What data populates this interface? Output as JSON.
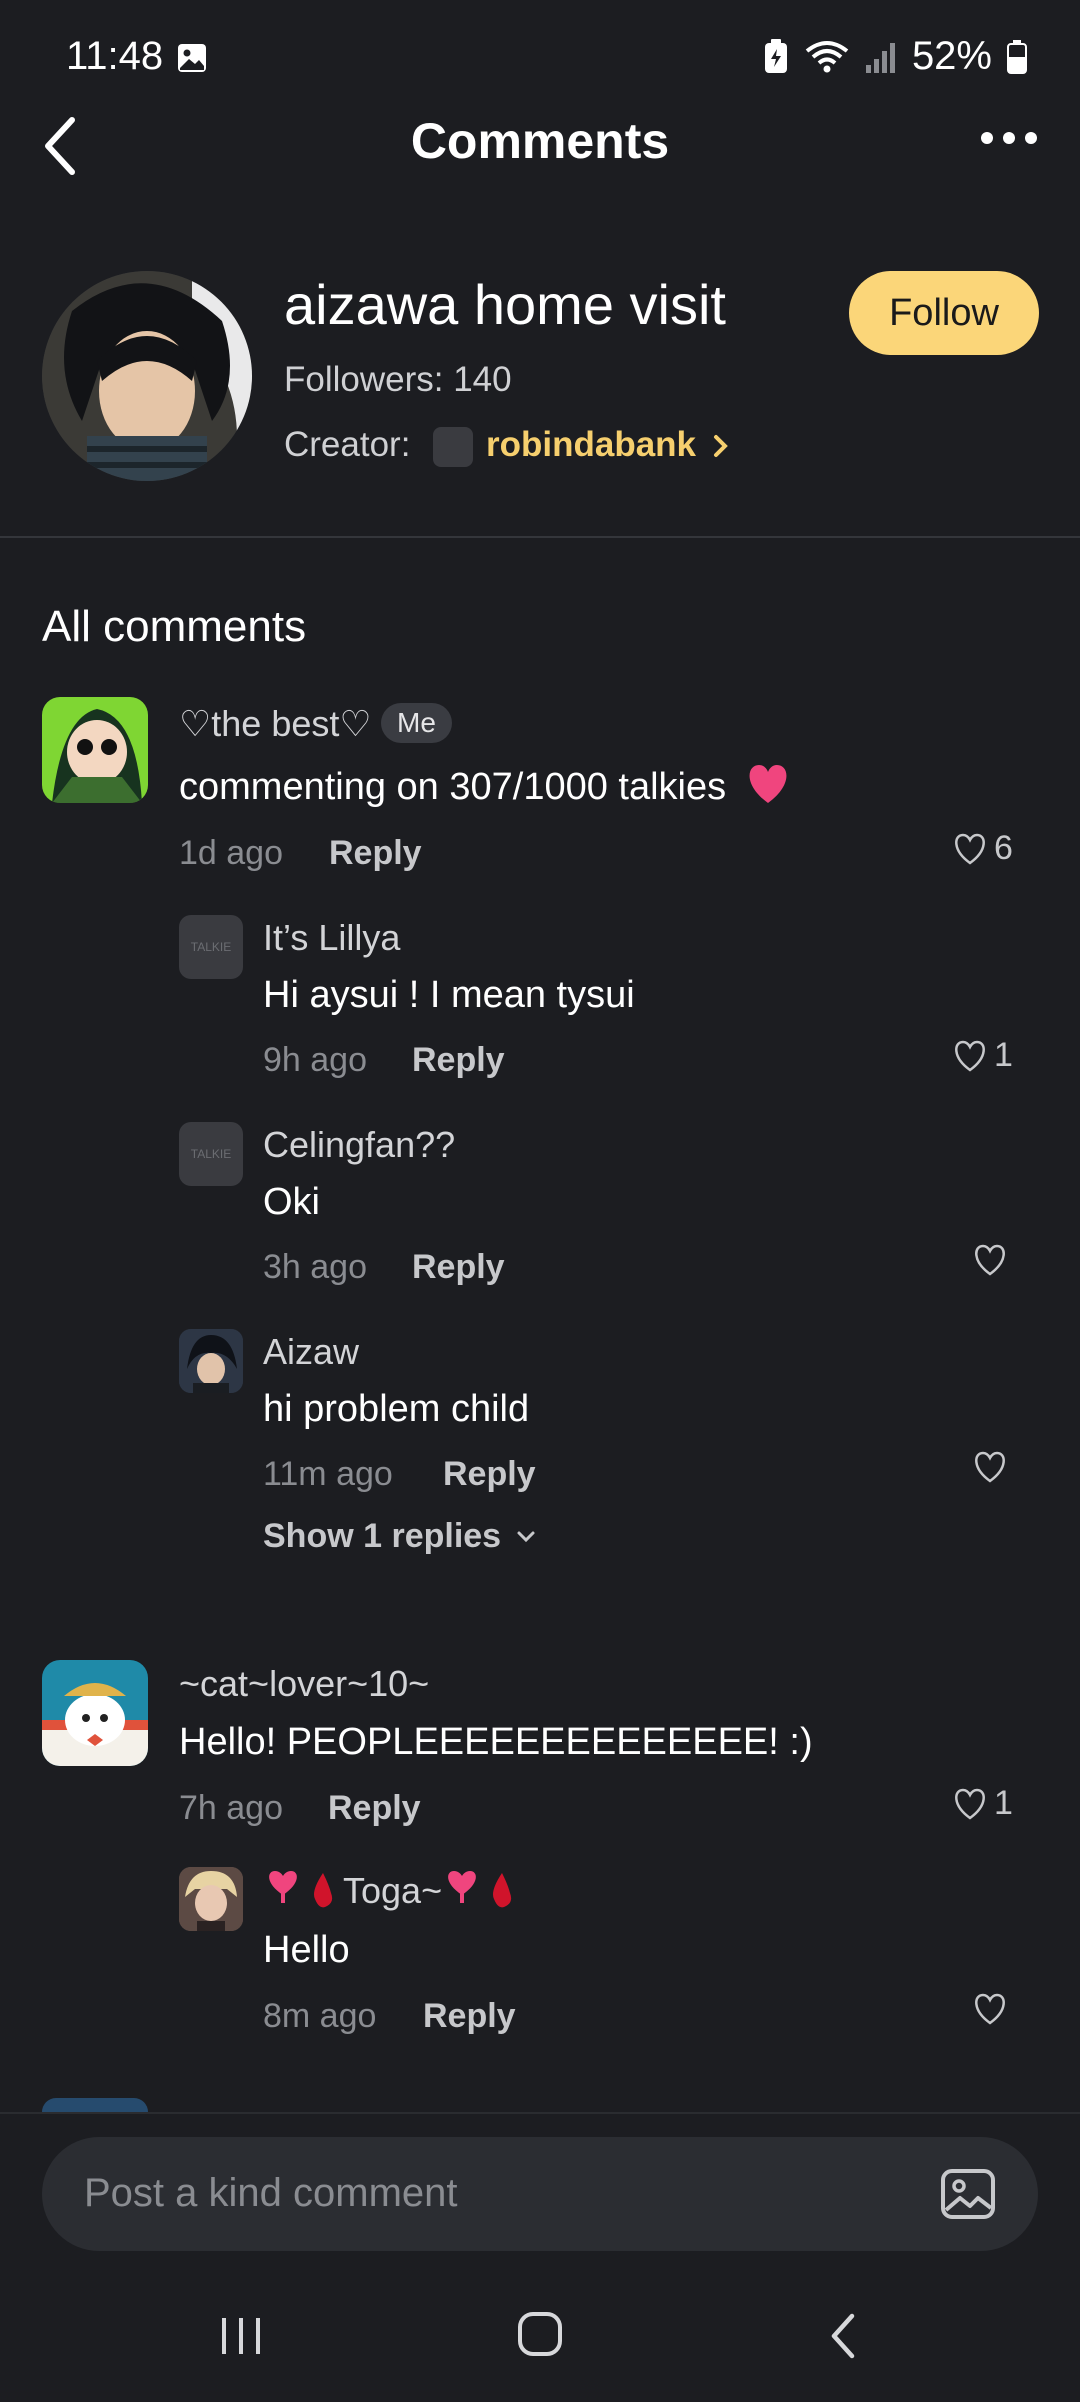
{
  "status_bar": {
    "time": "11:48",
    "battery": "52%"
  },
  "header": {
    "title": "Comments"
  },
  "story": {
    "title": "aizawa home visit",
    "followers": "Followers: 140",
    "creator_label": "Creator:",
    "creator_name": "robindabank",
    "follow_label": "Follow"
  },
  "section_title": "All comments",
  "comments": [
    {
      "user": "♡the best♡",
      "badge": "Me",
      "text": "commenting on 307/1000 talkies",
      "time": "1d ago",
      "reply": "Reply",
      "likes": "6",
      "replies": [
        {
          "user": "It’s Lillya",
          "text": "Hi aysui ! I mean tysui",
          "time": "9h ago",
          "reply": "Reply",
          "likes": "1"
        },
        {
          "user": "Celingfan??",
          "text": "Oki",
          "time": "3h ago",
          "reply": "Reply",
          "likes": ""
        },
        {
          "user": "Aizaw",
          "text": "hi problem child",
          "time": "11m ago",
          "reply": "Reply",
          "likes": ""
        }
      ],
      "show_more": "Show 1 replies"
    },
    {
      "user": "~cat~lover~10~",
      "text": "Hello! PEOPLEEEEEEEEEEEEEE! :)",
      "time": "7h ago",
      "reply": "Reply",
      "likes": "1",
      "replies": [
        {
          "user": "Toga~",
          "text": "Hello",
          "time": "8m ago",
          "reply": "Reply",
          "likes": ""
        }
      ]
    }
  ],
  "input": {
    "placeholder": "Post a kind comment"
  },
  "colors": {
    "background": "#1c1d21",
    "accent": "#fbd679",
    "creator": "#f6cf6e"
  }
}
